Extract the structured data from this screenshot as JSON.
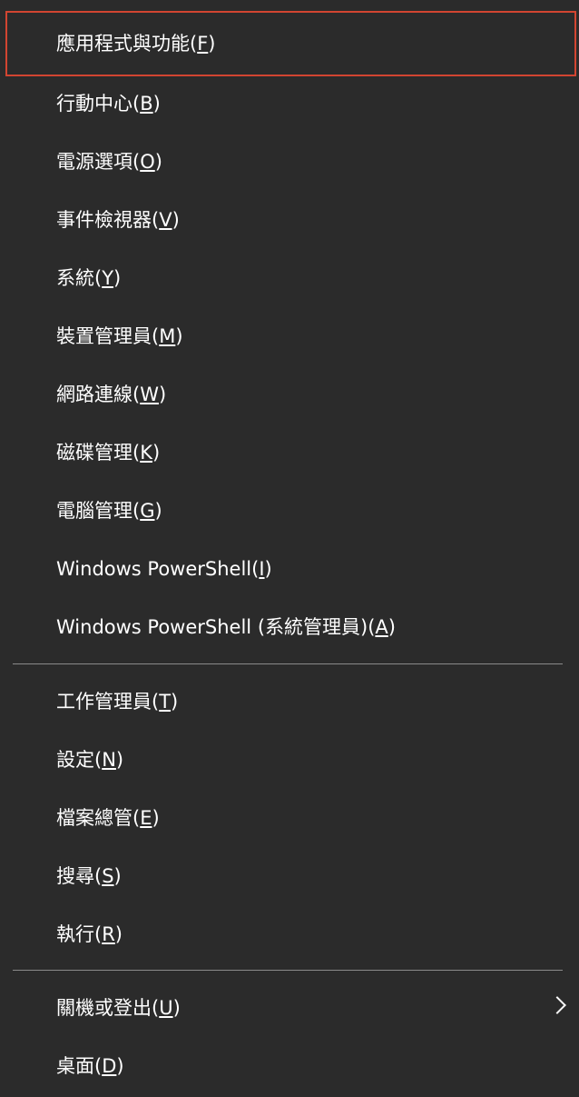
{
  "menu": {
    "items": [
      {
        "text": "應用程式與功能",
        "key": "F"
      },
      {
        "text": "行動中心",
        "key": "B"
      },
      {
        "text": "電源選項",
        "key": "O"
      },
      {
        "text": "事件檢視器",
        "key": "V"
      },
      {
        "text": "系統",
        "key": "Y"
      },
      {
        "text": "裝置管理員",
        "key": "M"
      },
      {
        "text": "網路連線",
        "key": "W"
      },
      {
        "text": "磁碟管理",
        "key": "K"
      },
      {
        "text": "電腦管理",
        "key": "G"
      },
      {
        "text": "Windows PowerShell",
        "key": "I"
      },
      {
        "text": "Windows PowerShell (系統管理員)",
        "key": "A"
      },
      {
        "text": "工作管理員",
        "key": "T"
      },
      {
        "text": "設定",
        "key": "N"
      },
      {
        "text": "檔案總管",
        "key": "E"
      },
      {
        "text": "搜尋",
        "key": "S"
      },
      {
        "text": "執行",
        "key": "R"
      },
      {
        "text": "關機或登出",
        "key": "U"
      },
      {
        "text": "桌面",
        "key": "D"
      }
    ]
  },
  "colors": {
    "background": "#2b2b2b",
    "text": "#ffffff",
    "focus_border": "#d24531",
    "separator": "#8a8a8a"
  },
  "icons": {
    "submenu": "chevron-right-icon"
  }
}
